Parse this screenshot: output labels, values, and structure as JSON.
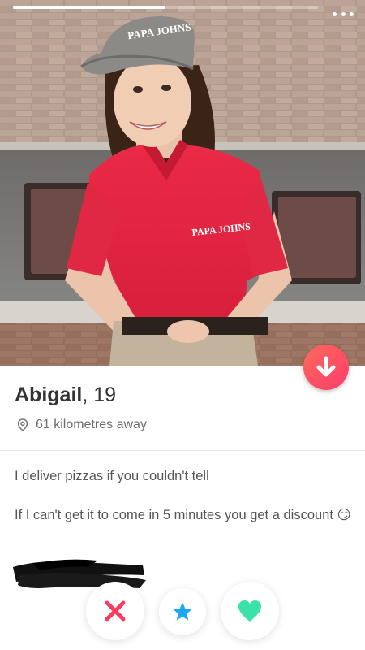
{
  "profile": {
    "name": "Abigail",
    "age_text": ", 19",
    "distance": "61 kilometres away",
    "bio": [
      "I deliver pizzas if you couldn't tell",
      "If I can't get it to come in 5 minutes you get a discount 😏"
    ]
  },
  "photo": {
    "visor_text": "PAPA JOHNS",
    "shirt_logo_text": "PAPA JOHNS",
    "photo_progress_fraction": 0.5
  },
  "icons": {
    "more": "more-horizontal-icon",
    "down": "arrow-down-icon",
    "location": "location-pin-icon",
    "nope": "close-icon",
    "super_like": "star-icon",
    "like": "heart-icon"
  },
  "colors": {
    "brand_gradient_start": "#ff6b5b",
    "brand_gradient_end": "#fd3b6d",
    "nope": "#fd3b5f",
    "super_like": "#1ca8f5",
    "like": "#3be2a8"
  }
}
